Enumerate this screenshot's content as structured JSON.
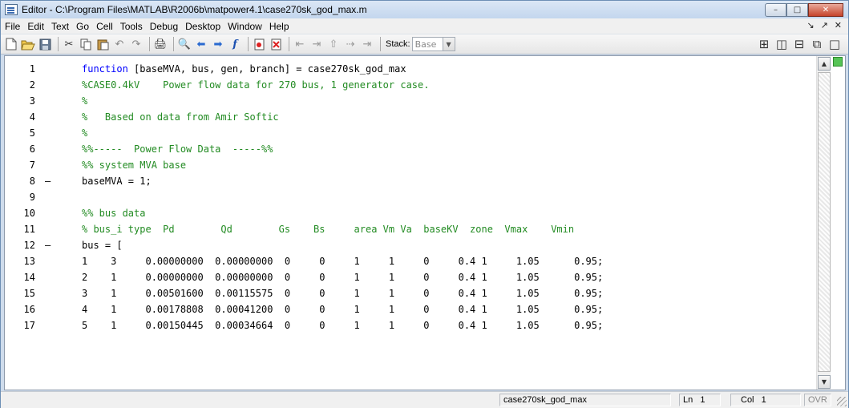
{
  "window": {
    "title": "Editor - C:\\Program Files\\MATLAB\\R2006b\\matpower4.1\\case270sk_god_max.m",
    "controls": {
      "minimize": "–",
      "maximize": "□",
      "close": "✕"
    }
  },
  "menubar": {
    "items": [
      "File",
      "Edit",
      "Text",
      "Go",
      "Cell",
      "Tools",
      "Debug",
      "Desktop",
      "Window",
      "Help"
    ],
    "dock_controls": [
      "↘",
      "↗",
      "✕"
    ]
  },
  "toolbar": {
    "icons": [
      "new-file-icon",
      "open-file-icon",
      "save-icon",
      "cut-icon",
      "copy-icon",
      "paste-icon",
      "undo-icon",
      "redo-icon",
      "print-icon",
      "find-icon",
      "back-icon",
      "forward-icon",
      "function-icon",
      "set-breakpoint-icon",
      "clear-breakpoints-icon",
      "step-icon",
      "step-in-icon",
      "step-out-icon",
      "continue-icon",
      "exit-debug-icon"
    ],
    "stack_label": "Stack:",
    "stack_value": "Base",
    "layout_icons": [
      "tile-icon",
      "split-vertical-icon",
      "split-horizontal-icon",
      "float-icon",
      "maximize-doc-icon"
    ]
  },
  "editor": {
    "lines": [
      {
        "num": "1",
        "bp": "",
        "segments": [
          {
            "t": "function",
            "c": "kw"
          },
          {
            "t": " [baseMVA, bus, gen, branch] = case270sk_god_max",
            "c": "txt"
          }
        ]
      },
      {
        "num": "2",
        "bp": "",
        "segments": [
          {
            "t": "%CASE0.4kV    Power flow data for 270 bus, 1 generator case.",
            "c": "cm"
          }
        ]
      },
      {
        "num": "3",
        "bp": "",
        "segments": [
          {
            "t": "%",
            "c": "cm"
          }
        ]
      },
      {
        "num": "4",
        "bp": "",
        "segments": [
          {
            "t": "%   Based on data from Amir Softic",
            "c": "cm"
          }
        ]
      },
      {
        "num": "5",
        "bp": "",
        "segments": [
          {
            "t": "%",
            "c": "cm"
          }
        ]
      },
      {
        "num": "6",
        "bp": "",
        "segments": [
          {
            "t": "%%-----  Power Flow Data  -----%%",
            "c": "cm"
          }
        ]
      },
      {
        "num": "7",
        "bp": "",
        "segments": [
          {
            "t": "%% system MVA base",
            "c": "cm"
          }
        ]
      },
      {
        "num": "8",
        "bp": "–",
        "segments": [
          {
            "t": "baseMVA = 1;",
            "c": "txt"
          }
        ]
      },
      {
        "num": "9",
        "bp": "",
        "segments": [
          {
            "t": "",
            "c": "txt"
          }
        ]
      },
      {
        "num": "10",
        "bp": "",
        "segments": [
          {
            "t": "%% bus data",
            "c": "cm"
          }
        ]
      },
      {
        "num": "11",
        "bp": "",
        "segments": [
          {
            "t": "% bus_i type  Pd        Qd        Gs    Bs     area Vm Va  baseKV  zone  Vmax    Vmin",
            "c": "cm"
          }
        ]
      },
      {
        "num": "12",
        "bp": "–",
        "segments": [
          {
            "t": "bus = [",
            "c": "txt"
          }
        ]
      },
      {
        "num": "13",
        "bp": "",
        "segments": [
          {
            "t": "1    3     0.00000000  0.00000000  0     0     1     1     0     0.4 1     1.05      0.95;",
            "c": "txt"
          }
        ]
      },
      {
        "num": "14",
        "bp": "",
        "segments": [
          {
            "t": "2    1     0.00000000  0.00000000  0     0     1     1     0     0.4 1     1.05      0.95;",
            "c": "txt"
          }
        ]
      },
      {
        "num": "15",
        "bp": "",
        "segments": [
          {
            "t": "3    1     0.00501600  0.00115575  0     0     1     1     0     0.4 1     1.05      0.95;",
            "c": "txt"
          }
        ]
      },
      {
        "num": "16",
        "bp": "",
        "segments": [
          {
            "t": "4    1     0.00178808  0.00041200  0     0     1     1     0     0.4 1     1.05      0.95;",
            "c": "txt"
          }
        ]
      },
      {
        "num": "17",
        "bp": "",
        "segments": [
          {
            "t": "5    1     0.00150445  0.00034664  0     0     1     1     0     0.4 1     1.05      0.95;",
            "c": "txt"
          }
        ]
      }
    ]
  },
  "statusbar": {
    "function_name": "case270sk_god_max",
    "ln_label": "Ln",
    "ln_value": "1",
    "col_label": "Col",
    "col_value": "1",
    "mode": "OVR"
  },
  "colors": {
    "keyword": "#0000ff",
    "comment": "#228b22",
    "mlint_ok": "#56c456"
  }
}
